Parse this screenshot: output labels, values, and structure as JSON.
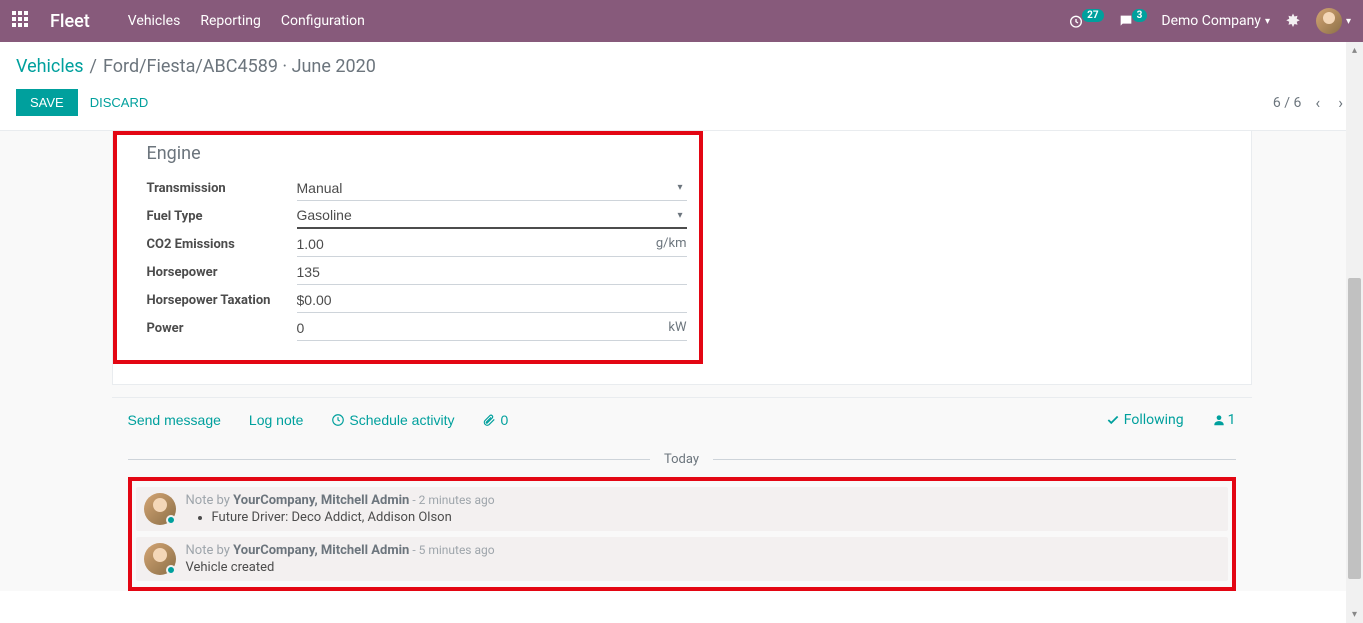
{
  "navbar": {
    "app_title": "Fleet",
    "menu": [
      "Vehicles",
      "Reporting",
      "Configuration"
    ],
    "timer_badge": "27",
    "chat_badge": "3",
    "company": "Demo Company"
  },
  "breadcrumb": {
    "root": "Vehicles",
    "current": "Ford/Fiesta/ABC4589 · June 2020"
  },
  "actions": {
    "save": "SAVE",
    "discard": "DISCARD",
    "pager": "6 / 6"
  },
  "engine": {
    "title": "Engine",
    "fields": {
      "transmission": {
        "label": "Transmission",
        "value": "Manual"
      },
      "fuel_type": {
        "label": "Fuel Type",
        "value": "Gasoline"
      },
      "co2": {
        "label": "CO2 Emissions",
        "value": "1.00",
        "unit": "g/km"
      },
      "horsepower": {
        "label": "Horsepower",
        "value": "135"
      },
      "hp_tax": {
        "label": "Horsepower Taxation",
        "value": "$0.00"
      },
      "power": {
        "label": "Power",
        "value": "0",
        "unit": "kW"
      }
    }
  },
  "chatter": {
    "send_message": "Send message",
    "log_note": "Log note",
    "schedule_activity": "Schedule activity",
    "attachments": "0",
    "following": "Following",
    "followers": "1",
    "today": "Today",
    "notes": [
      {
        "prefix": "Note by ",
        "author": "YourCompany, Mitchell Admin",
        "time": " - 2 minutes ago",
        "bullets": [
          "Future Driver: Deco Addict, Addison Olson"
        ]
      },
      {
        "prefix": "Note by ",
        "author": "YourCompany, Mitchell Admin",
        "time": " - 5 minutes ago",
        "text": "Vehicle created"
      }
    ]
  }
}
